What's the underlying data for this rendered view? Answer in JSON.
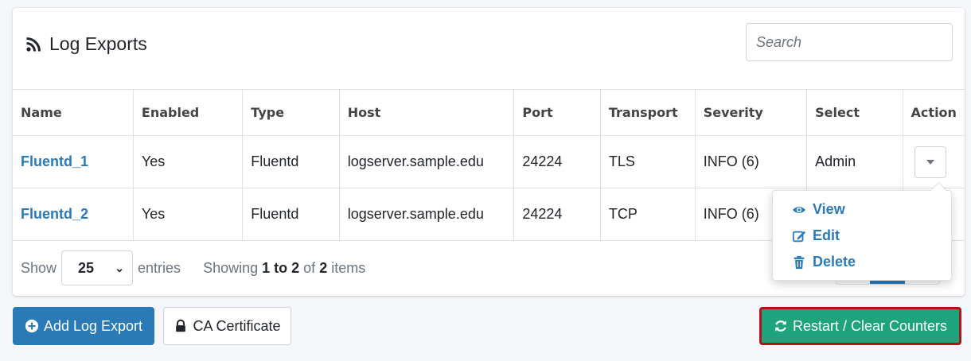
{
  "header": {
    "title": "Log Exports",
    "title_icon": "rss-icon",
    "search_placeholder": "Search"
  },
  "table": {
    "columns": [
      "Name",
      "Enabled",
      "Type",
      "Host",
      "Port",
      "Transport",
      "Severity",
      "Select",
      "Action"
    ],
    "rows": [
      {
        "name": "Fluentd_1",
        "enabled": "Yes",
        "type": "Fluentd",
        "host": "logserver.sample.edu",
        "port": "24224",
        "transport": "TLS",
        "severity": "INFO (6)",
        "select": "Admin"
      },
      {
        "name": "Fluentd_2",
        "enabled": "Yes",
        "type": "Fluentd",
        "host": "logserver.sample.edu",
        "port": "24224",
        "transport": "TCP",
        "severity": "INFO (6)",
        "select": ""
      }
    ]
  },
  "footer": {
    "show_label": "Show",
    "page_length": "25",
    "entries_label": "entries",
    "info_prefix": "Showing",
    "info_range": "1 to 2",
    "info_of": "of",
    "info_total": "2",
    "info_suffix": "items"
  },
  "action_menu": {
    "items": [
      {
        "label": "View",
        "icon": "eye-icon"
      },
      {
        "label": "Edit",
        "icon": "edit-icon"
      },
      {
        "label": "Delete",
        "icon": "trash-icon"
      }
    ]
  },
  "buttons": {
    "add_label": "Add Log Export",
    "ca_label": "CA Certificate",
    "restart_label": "Restart / Clear Counters"
  },
  "colors": {
    "link": "#2a7ab8",
    "primary": "#2a7ab8",
    "success": "#1fa37d",
    "highlight_border": "#b0141a"
  }
}
